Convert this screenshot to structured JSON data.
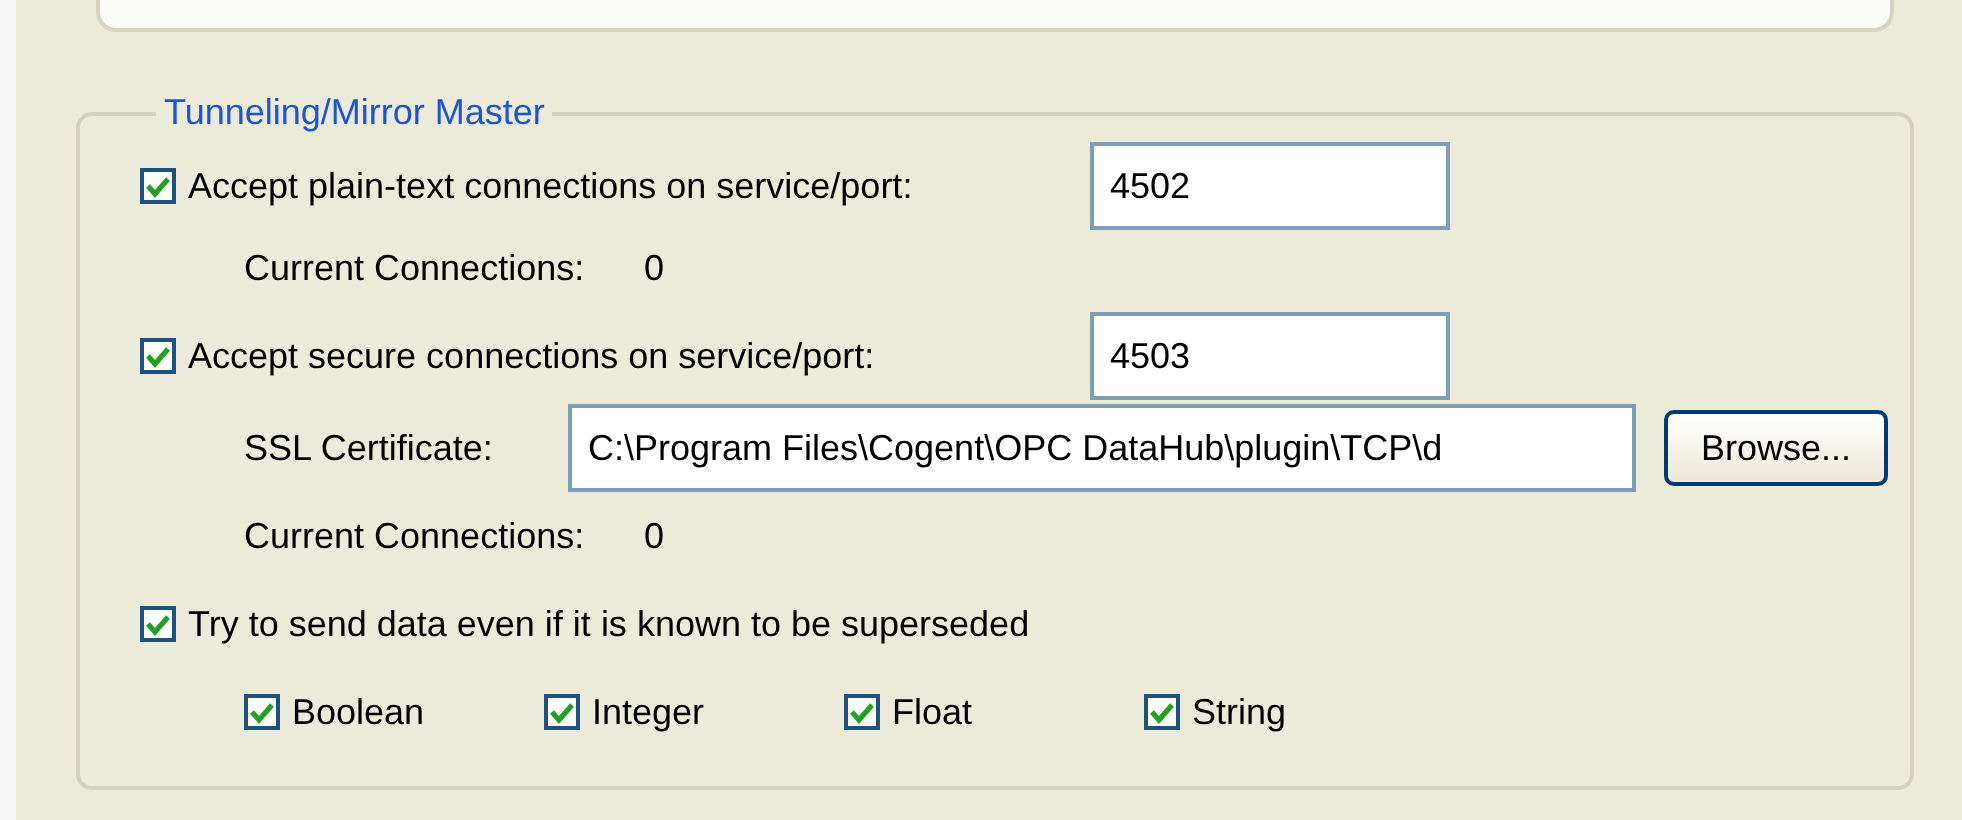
{
  "group": {
    "title": "Tunneling/Mirror Master"
  },
  "plain": {
    "label": "Accept plain-text connections on service/port:",
    "checked": true,
    "port": "4502",
    "connections_label": "Current Connections:",
    "connections": "0"
  },
  "secure": {
    "label": "Accept secure connections on service/port:",
    "checked": true,
    "port": "4503",
    "cert_label": "SSL Certificate:",
    "cert_path": "C:\\Program Files\\Cogent\\OPC DataHub\\plugin\\TCP\\d",
    "browse": "Browse...",
    "connections_label": "Current Connections:",
    "connections": "0"
  },
  "superseded": {
    "label": "Try to send data even if it is known to be superseded",
    "checked": true
  },
  "types": [
    {
      "label": "Boolean",
      "checked": true
    },
    {
      "label": "Integer",
      "checked": true
    },
    {
      "label": "Float",
      "checked": true
    },
    {
      "label": "String",
      "checked": true
    }
  ]
}
